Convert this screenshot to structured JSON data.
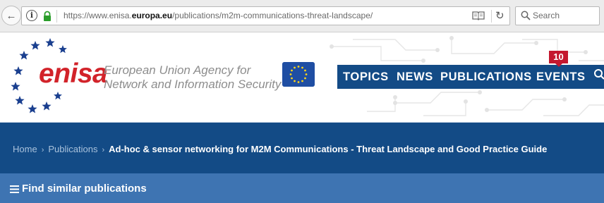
{
  "browser": {
    "url_prefix": "https://www.enisa.",
    "url_domain": "europa.eu",
    "url_path": "/publications/m2m-communications-threat-landscape/",
    "search_placeholder": "Search"
  },
  "header": {
    "logo_text": "enisa",
    "tagline_line1": "European Union Agency for",
    "tagline_line2": "Network and Information Security"
  },
  "nav": {
    "items": [
      "TOPICS",
      "NEWS",
      "PUBLICATIONS",
      "EVENTS"
    ],
    "events_badge": "10"
  },
  "breadcrumb": {
    "home": "Home",
    "section": "Publications",
    "current": "Ad-hoc & sensor networking for M2M Communications - Threat Landscape and Good Practice Guide"
  },
  "find_bar": {
    "label": "Find similar publications"
  },
  "colors": {
    "brand_red": "#d2232a",
    "nav_blue": "#134b86",
    "find_blue": "#3e74b2",
    "badge_red": "#c4182f"
  }
}
